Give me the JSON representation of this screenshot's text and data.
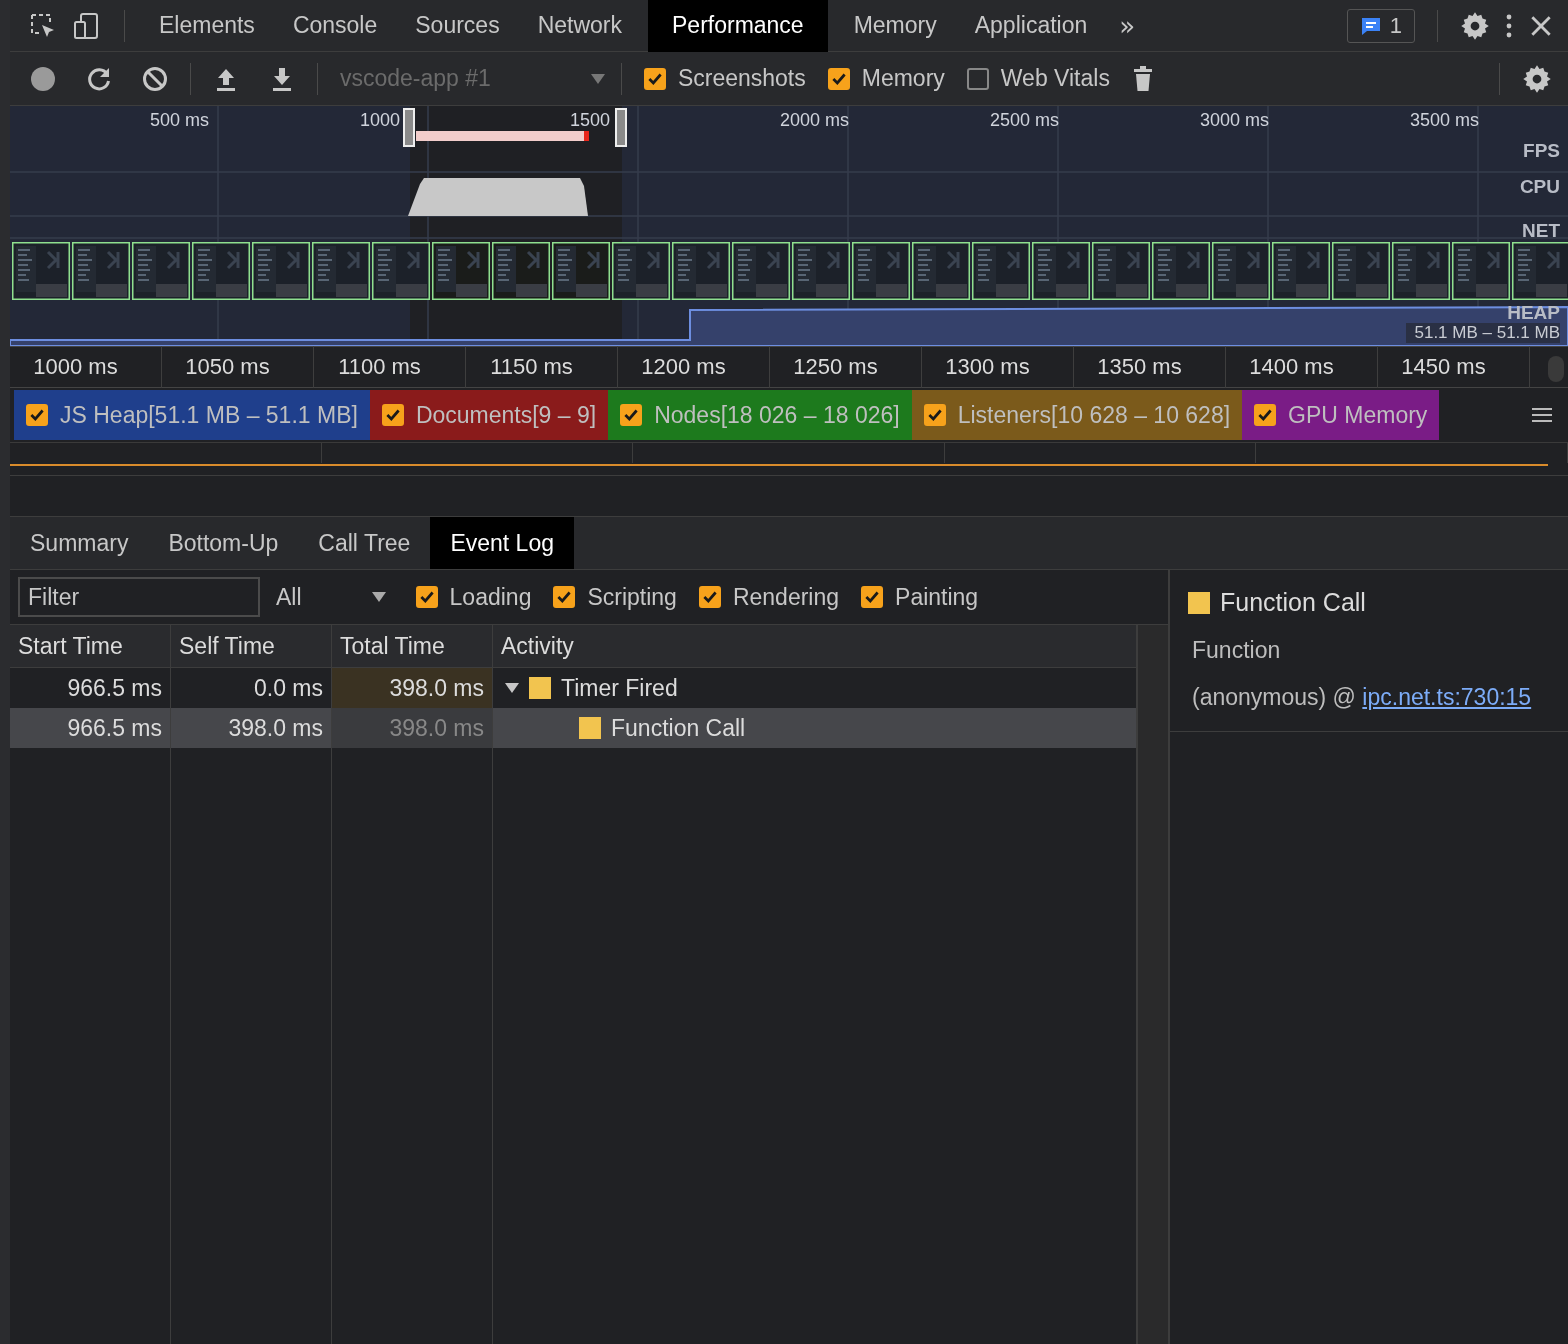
{
  "main_tabs": [
    {
      "label": "Elements",
      "selected": false
    },
    {
      "label": "Console",
      "selected": false
    },
    {
      "label": "Sources",
      "selected": false
    },
    {
      "label": "Network",
      "selected": false
    },
    {
      "label": "Performance",
      "selected": true
    },
    {
      "label": "Memory",
      "selected": false
    },
    {
      "label": "Application",
      "selected": false
    }
  ],
  "more_tabs": "»",
  "issues_count": "1",
  "toolbar": {
    "target": "vscode-app #1",
    "options": [
      {
        "label": "Screenshots",
        "checked": true
      },
      {
        "label": "Memory",
        "checked": true
      },
      {
        "label": "Web Vitals",
        "checked": false
      }
    ]
  },
  "overview": {
    "ticks": [
      "500 ms",
      "1000",
      "1500",
      "2000 ms",
      "2500 ms",
      "3000 ms",
      "3500 ms"
    ],
    "tracks": [
      "FPS",
      "CPU",
      "NET",
      "HEAP"
    ],
    "heap_range": "51.1 MB – 51.1 MB"
  },
  "timeline_ticks": [
    "1000 ms",
    "1050 ms",
    "1100 ms",
    "1150 ms",
    "1200 ms",
    "1250 ms",
    "1300 ms",
    "1350 ms",
    "1400 ms",
    "1450 ms"
  ],
  "counters": [
    {
      "label": "JS Heap[51.1 MB – 51.1 MB]",
      "checked": true,
      "color": "#1f3f8c"
    },
    {
      "label": "Documents[9 – 9]",
      "checked": true,
      "color": "#8a1b1b"
    },
    {
      "label": "Nodes[18 026 – 18 026]",
      "checked": true,
      "color": "#1d7a1d"
    },
    {
      "label": "Listeners[10 628 – 10 628]",
      "checked": true,
      "color": "#7b5a1b"
    },
    {
      "label": "GPU Memory",
      "checked": true,
      "color": "#7a1c86"
    }
  ],
  "detail_tabs": [
    {
      "label": "Summary",
      "selected": false
    },
    {
      "label": "Bottom-Up",
      "selected": false
    },
    {
      "label": "Call Tree",
      "selected": false
    },
    {
      "label": "Event Log",
      "selected": true
    }
  ],
  "filter": {
    "placeholder": "Filter",
    "duration": "All",
    "categories": [
      {
        "label": "Loading",
        "checked": true
      },
      {
        "label": "Scripting",
        "checked": true
      },
      {
        "label": "Rendering",
        "checked": true
      },
      {
        "label": "Painting",
        "checked": true
      }
    ]
  },
  "table": {
    "columns": [
      "Start Time",
      "Self Time",
      "Total Time",
      "Activity"
    ],
    "rows": [
      {
        "start": "966.5 ms",
        "self": "0.0 ms",
        "total": "398.0 ms",
        "activity": "Timer Fired",
        "color": "#f2c44f",
        "expanded": true,
        "selected": false,
        "children": [
          {
            "start": "966.5 ms",
            "self": "398.0 ms",
            "total": "398.0 ms",
            "activity": "Function Call",
            "color": "#f2c44f",
            "selected": true
          }
        ]
      }
    ]
  },
  "details": {
    "title": "Function Call",
    "color": "#f2c44f",
    "label": "Function",
    "value": "(anonymous) @ ",
    "link": "ipc.net.ts:730:15"
  }
}
